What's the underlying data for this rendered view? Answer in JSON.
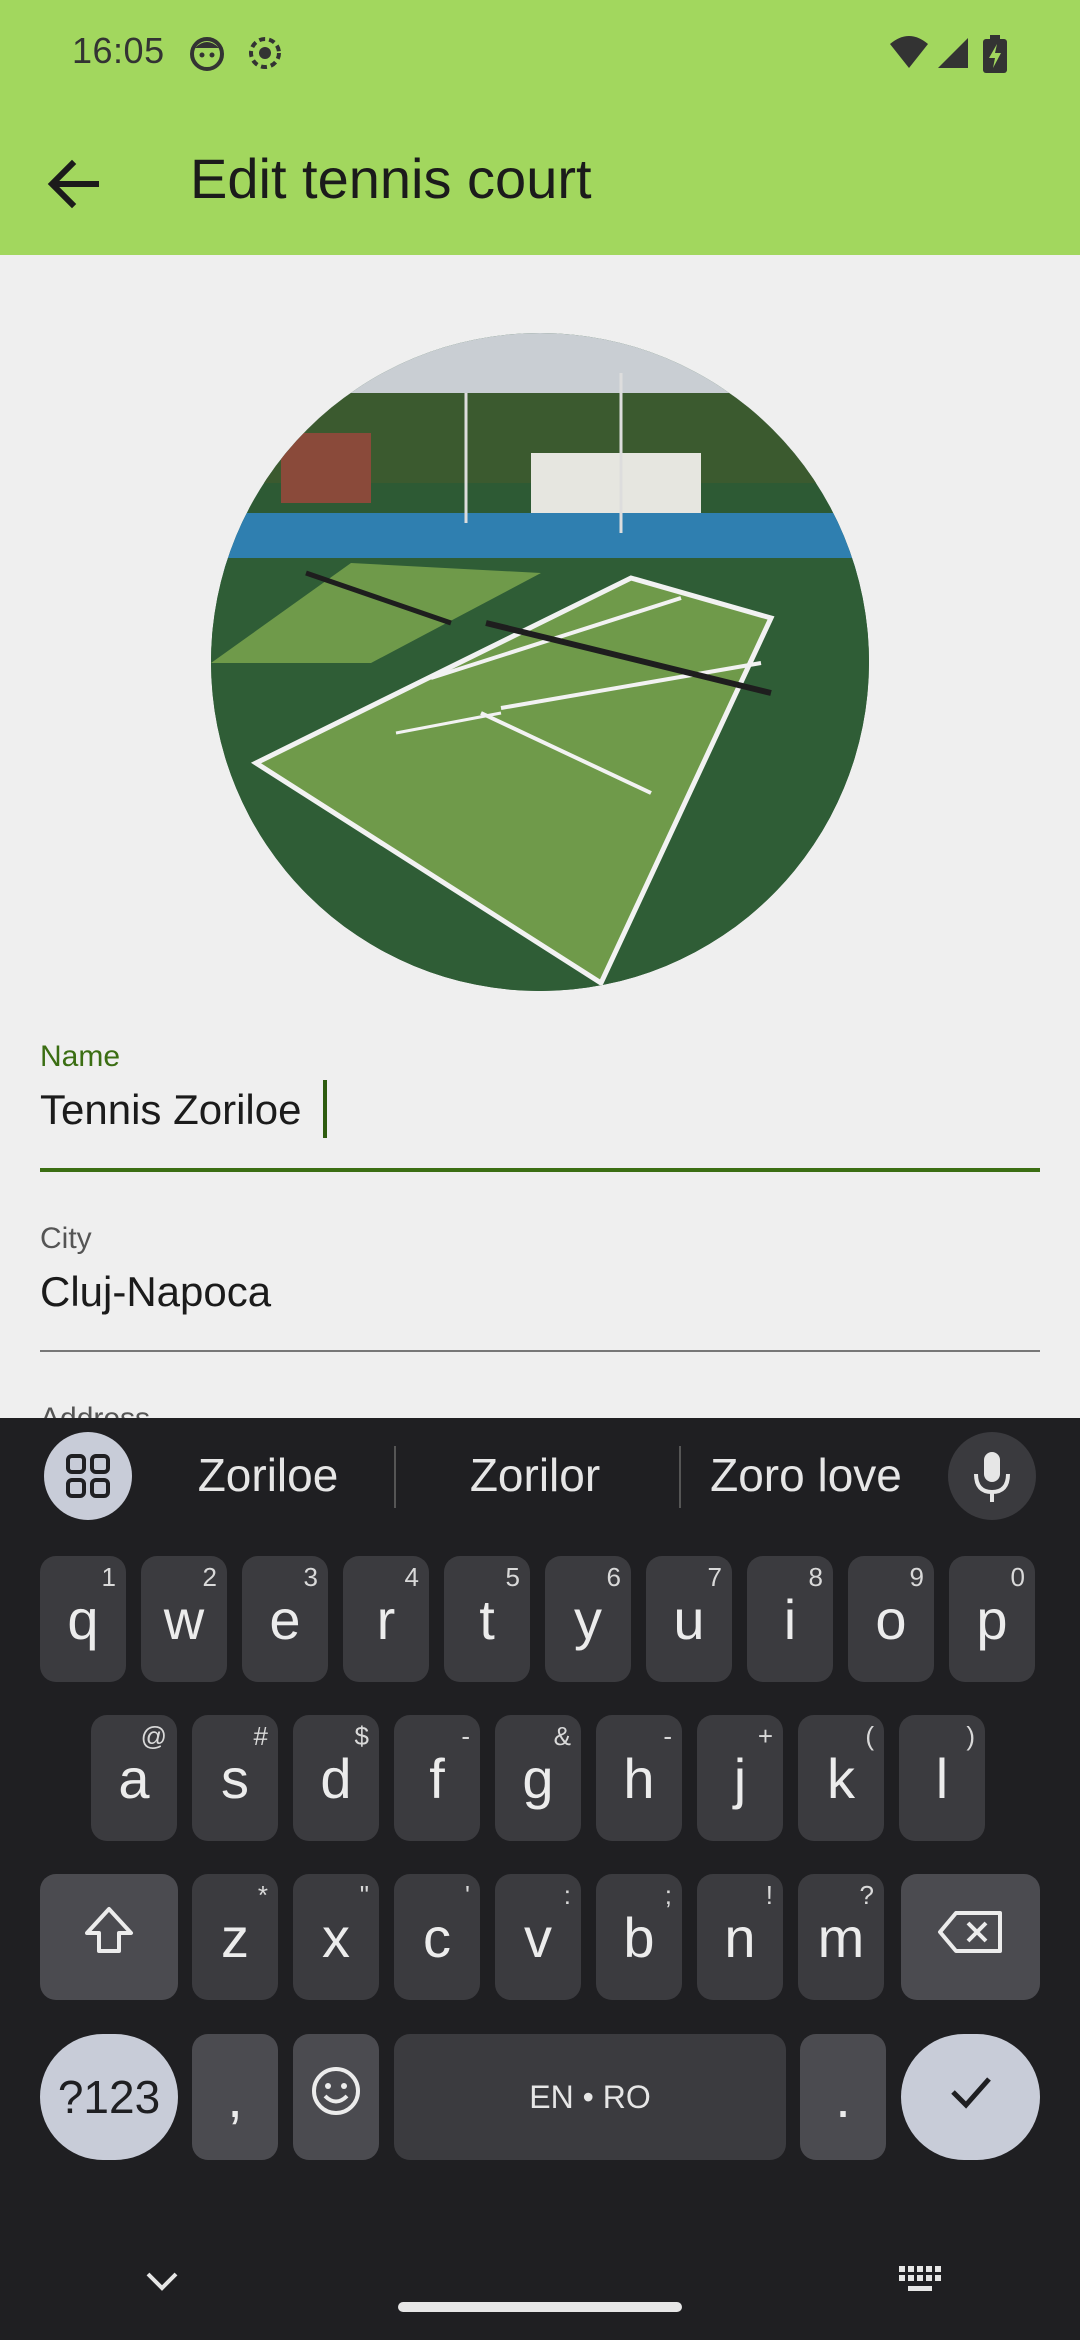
{
  "status_bar": {
    "time": "16:05"
  },
  "app_bar": {
    "title": "Edit tennis court"
  },
  "form": {
    "name": {
      "label": "Name",
      "value": "Tennis Zoriloe"
    },
    "city": {
      "label": "City",
      "value": "Cluj-Napoca"
    },
    "address": {
      "label": "Address"
    }
  },
  "keyboard": {
    "suggestions": [
      "Zoriloe",
      "Zorilor",
      "Zoro love"
    ],
    "row1": [
      {
        "k": "q",
        "h": "1"
      },
      {
        "k": "w",
        "h": "2"
      },
      {
        "k": "e",
        "h": "3"
      },
      {
        "k": "r",
        "h": "4"
      },
      {
        "k": "t",
        "h": "5"
      },
      {
        "k": "y",
        "h": "6"
      },
      {
        "k": "u",
        "h": "7"
      },
      {
        "k": "i",
        "h": "8"
      },
      {
        "k": "o",
        "h": "9"
      },
      {
        "k": "p",
        "h": "0"
      }
    ],
    "row2": [
      {
        "k": "a",
        "h": "@"
      },
      {
        "k": "s",
        "h": "#"
      },
      {
        "k": "d",
        "h": "$"
      },
      {
        "k": "f",
        "h": "-"
      },
      {
        "k": "g",
        "h": "&"
      },
      {
        "k": "h",
        "h": "-"
      },
      {
        "k": "j",
        "h": "+"
      },
      {
        "k": "k",
        "h": "("
      },
      {
        "k": "l",
        "h": ")"
      }
    ],
    "row3": [
      {
        "k": "z",
        "h": "*"
      },
      {
        "k": "x",
        "h": "\""
      },
      {
        "k": "c",
        "h": "'"
      },
      {
        "k": "v",
        "h": ":"
      },
      {
        "k": "b",
        "h": ";"
      },
      {
        "k": "n",
        "h": "!"
      },
      {
        "k": "m",
        "h": "?"
      }
    ],
    "symbols_label": "?123",
    "comma": ",",
    "space_label": "EN • RO",
    "period": "."
  },
  "colors": {
    "app_bar": "#a2d75e",
    "accent": "#3b6e13",
    "keyboard_bg": "#1f1f22"
  }
}
